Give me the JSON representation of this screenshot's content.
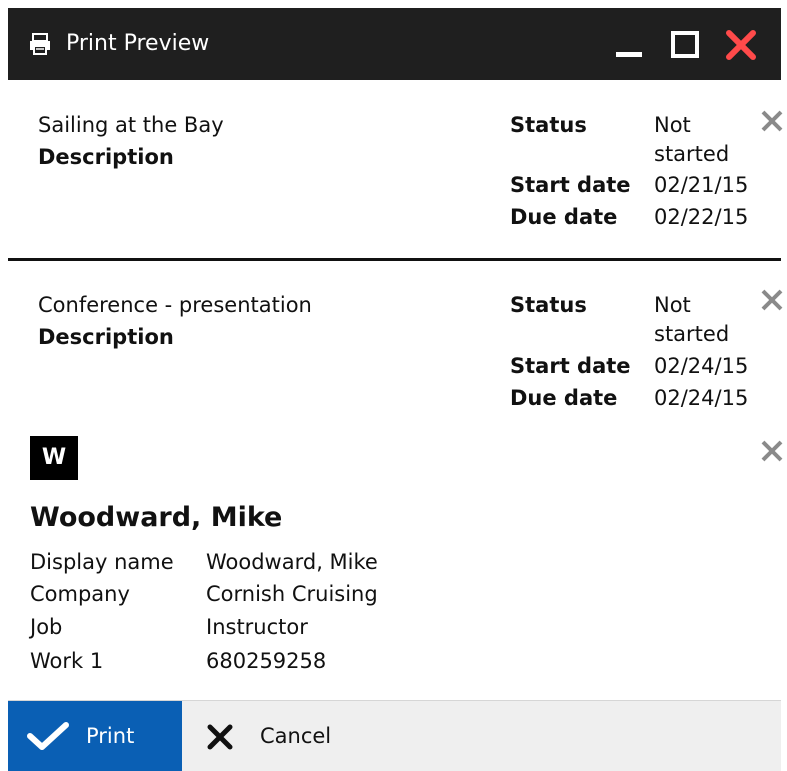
{
  "window": {
    "title": "Print Preview",
    "icons": {
      "app": "printer-icon",
      "minimize": "minimize-icon",
      "maximize": "maximize-icon",
      "close": "close-icon"
    },
    "close_color": "#ff4a4a"
  },
  "cards": [
    {
      "title": "Sailing at the Bay",
      "description_label": "Description",
      "status_label": "Status",
      "status_line1": "Not",
      "status_line2": "started",
      "start_label": "Start date",
      "start_value": "02/21/15",
      "due_label": "Due date",
      "due_value": "02/22/15"
    },
    {
      "title": "Conference - presentation",
      "description_label": "Description",
      "status_label": "Status",
      "status_line1": "Not",
      "status_line2": "started",
      "start_label": "Start date",
      "start_value": "02/24/15",
      "due_label": "Due date",
      "due_value": "02/24/15"
    }
  ],
  "contact": {
    "initial": "W",
    "name": "Woodward, Mike",
    "fields": [
      {
        "label": "Display name",
        "value": "Woodward, Mike"
      },
      {
        "label": "Company",
        "value": "Cornish Cruising"
      },
      {
        "label": "Job",
        "value": "Instructor"
      },
      {
        "label": "Work 1",
        "value": "680259258"
      }
    ]
  },
  "actions": {
    "print_label": "Print",
    "cancel_label": "Cancel",
    "print_color": "#0a5fb4"
  }
}
